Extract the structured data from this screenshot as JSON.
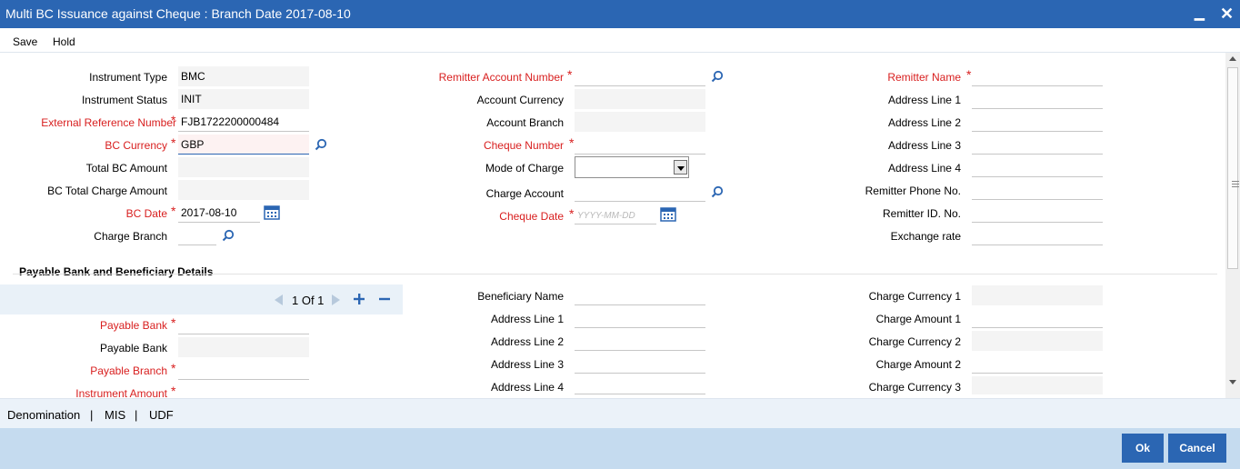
{
  "window": {
    "title": "Multi BC Issuance against Cheque : Branch Date 2017-08-10",
    "minimize": "▁",
    "close": "✕"
  },
  "toolbar": {
    "save": "Save",
    "hold": "Hold"
  },
  "left": {
    "instrument_type": {
      "label": "Instrument Type",
      "value": "BMC"
    },
    "instrument_status": {
      "label": "Instrument Status",
      "value": "INIT"
    },
    "external_ref": {
      "label": "External Reference Number",
      "value": "FJB1722200000484"
    },
    "bc_currency": {
      "label": "BC Currency",
      "value": "GBP"
    },
    "total_bc_amount": {
      "label": "Total BC Amount",
      "value": ""
    },
    "bc_total_charge": {
      "label": "BC Total Charge Amount",
      "value": ""
    },
    "bc_date": {
      "label": "BC Date",
      "value": "2017-08-10"
    },
    "charge_branch": {
      "label": "Charge Branch",
      "value": ""
    }
  },
  "middle": {
    "remitter_account": {
      "label": "Remitter Account Number",
      "value": ""
    },
    "account_currency": {
      "label": "Account Currency",
      "value": ""
    },
    "account_branch": {
      "label": "Account Branch",
      "value": ""
    },
    "cheque_number": {
      "label": "Cheque Number",
      "value": ""
    },
    "mode_of_charge": {
      "label": "Mode of Charge",
      "value": ""
    },
    "charge_account": {
      "label": "Charge Account",
      "value": ""
    },
    "cheque_date": {
      "label": "Cheque Date",
      "placeholder": "YYYY-MM-DD"
    }
  },
  "right": {
    "remitter_name": {
      "label": "Remitter Name"
    },
    "address1": {
      "label": "Address Line 1"
    },
    "address2": {
      "label": "Address Line 2"
    },
    "address3": {
      "label": "Address Line 3"
    },
    "address4": {
      "label": "Address Line 4"
    },
    "phone": {
      "label": "Remitter Phone No."
    },
    "remitter_id": {
      "label": "Remitter ID. No."
    },
    "exchange_rate": {
      "label": "Exchange rate"
    }
  },
  "payable": {
    "section_title": "Payable Bank and Beneficiary Details",
    "pager": {
      "text": "1 Of 1"
    },
    "payable_bank": {
      "label": "Payable Bank"
    },
    "payable_bank_name": {
      "label": "Payable Bank"
    },
    "payable_branch": {
      "label": "Payable Branch"
    },
    "instrument_amount": {
      "label": "Instrument Amount"
    },
    "beneficiary_name": {
      "label": "Beneficiary Name"
    },
    "ben_address1": {
      "label": "Address Line 1"
    },
    "ben_address2": {
      "label": "Address Line 2"
    },
    "ben_address3": {
      "label": "Address Line 3"
    },
    "ben_address4": {
      "label": "Address Line 4"
    },
    "charge_currency1": {
      "label": "Charge Currency 1"
    },
    "charge_amount1": {
      "label": "Charge Amount 1"
    },
    "charge_currency2": {
      "label": "Charge Currency 2"
    },
    "charge_amount2": {
      "label": "Charge Amount 2"
    },
    "charge_currency3": {
      "label": "Charge Currency 3"
    }
  },
  "subnav": {
    "denomination": "Denomination",
    "mis": "MIS",
    "udf": "UDF",
    "separator": "|"
  },
  "footer": {
    "ok": "Ok",
    "cancel": "Cancel"
  },
  "icons": {
    "lookup": "search-icon",
    "calendar": "calendar-icon"
  },
  "colors": {
    "accent": "#2b66b3",
    "required": "#d81e1e",
    "footer_bg": "#c5dbef"
  }
}
